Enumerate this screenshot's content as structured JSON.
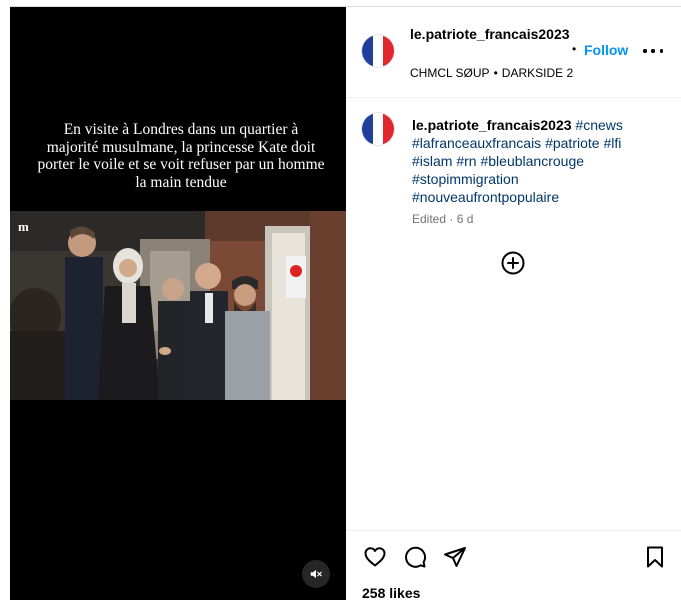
{
  "post": {
    "overlay_text": "En visite à Londres dans un quartier à majorité  musulmane, la princesse Kate doit porter le voile et se voit refuser par un homme la main tendue",
    "video_watermark": "m",
    "mute_icon": "speaker-muted-icon"
  },
  "header": {
    "username": "le.patriote_francais2023",
    "separator": "•",
    "follow_label": "Follow",
    "audio_artist": "CHMCL SØUP",
    "audio_separator": "•",
    "audio_track": "DARKSIDE 2",
    "more_icon": "more-options-icon"
  },
  "caption": {
    "username": "le.patriote_francais2023",
    "hashtags": [
      "#cnews",
      "#lafranceauxfrancais",
      "#patriote",
      "#lfi",
      "#islam",
      "#rn",
      "#bleublancrouge",
      "#stopimmigration",
      "#nouveaufrontpopulaire"
    ],
    "edited_label": "Edited",
    "dot": "·",
    "time": "6 d",
    "load_more_icon": "add-circle-icon"
  },
  "actions": {
    "like_icon": "heart-icon",
    "comment_icon": "comment-icon",
    "share_icon": "share-icon",
    "save_icon": "bookmark-icon",
    "likes_text": "258 likes"
  },
  "colors": {
    "link": "#0095f6",
    "hashtag": "#00376b",
    "flag_blue": "#1f3f9a",
    "flag_white": "#ffffff",
    "flag_red": "#e1262e"
  }
}
